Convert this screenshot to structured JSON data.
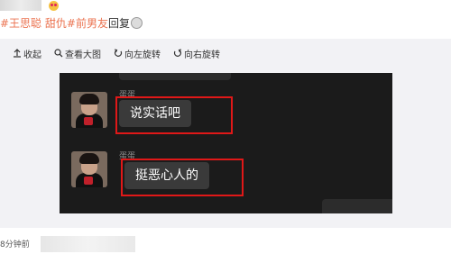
{
  "post": {
    "hashtag_1": "#王思聪",
    "name": "甜仇",
    "hashtag_2": "#前男友",
    "suffix": "回复"
  },
  "toolbar": {
    "collapse_label": "收起",
    "view_large_label": "查看大图",
    "rotate_left_label": "向左旋转",
    "rotate_right_label": "向右旋转"
  },
  "chat": {
    "messages": [
      {
        "sender": "蛋蛋",
        "text": "说实话吧"
      },
      {
        "sender": "蛋蛋",
        "text": "挺恶心人的"
      }
    ]
  },
  "footer": {
    "time": "8分钟前"
  },
  "colors": {
    "tag": "#eb7350",
    "highlight_box": "#e01818",
    "chat_background": "#1b1b1b"
  }
}
